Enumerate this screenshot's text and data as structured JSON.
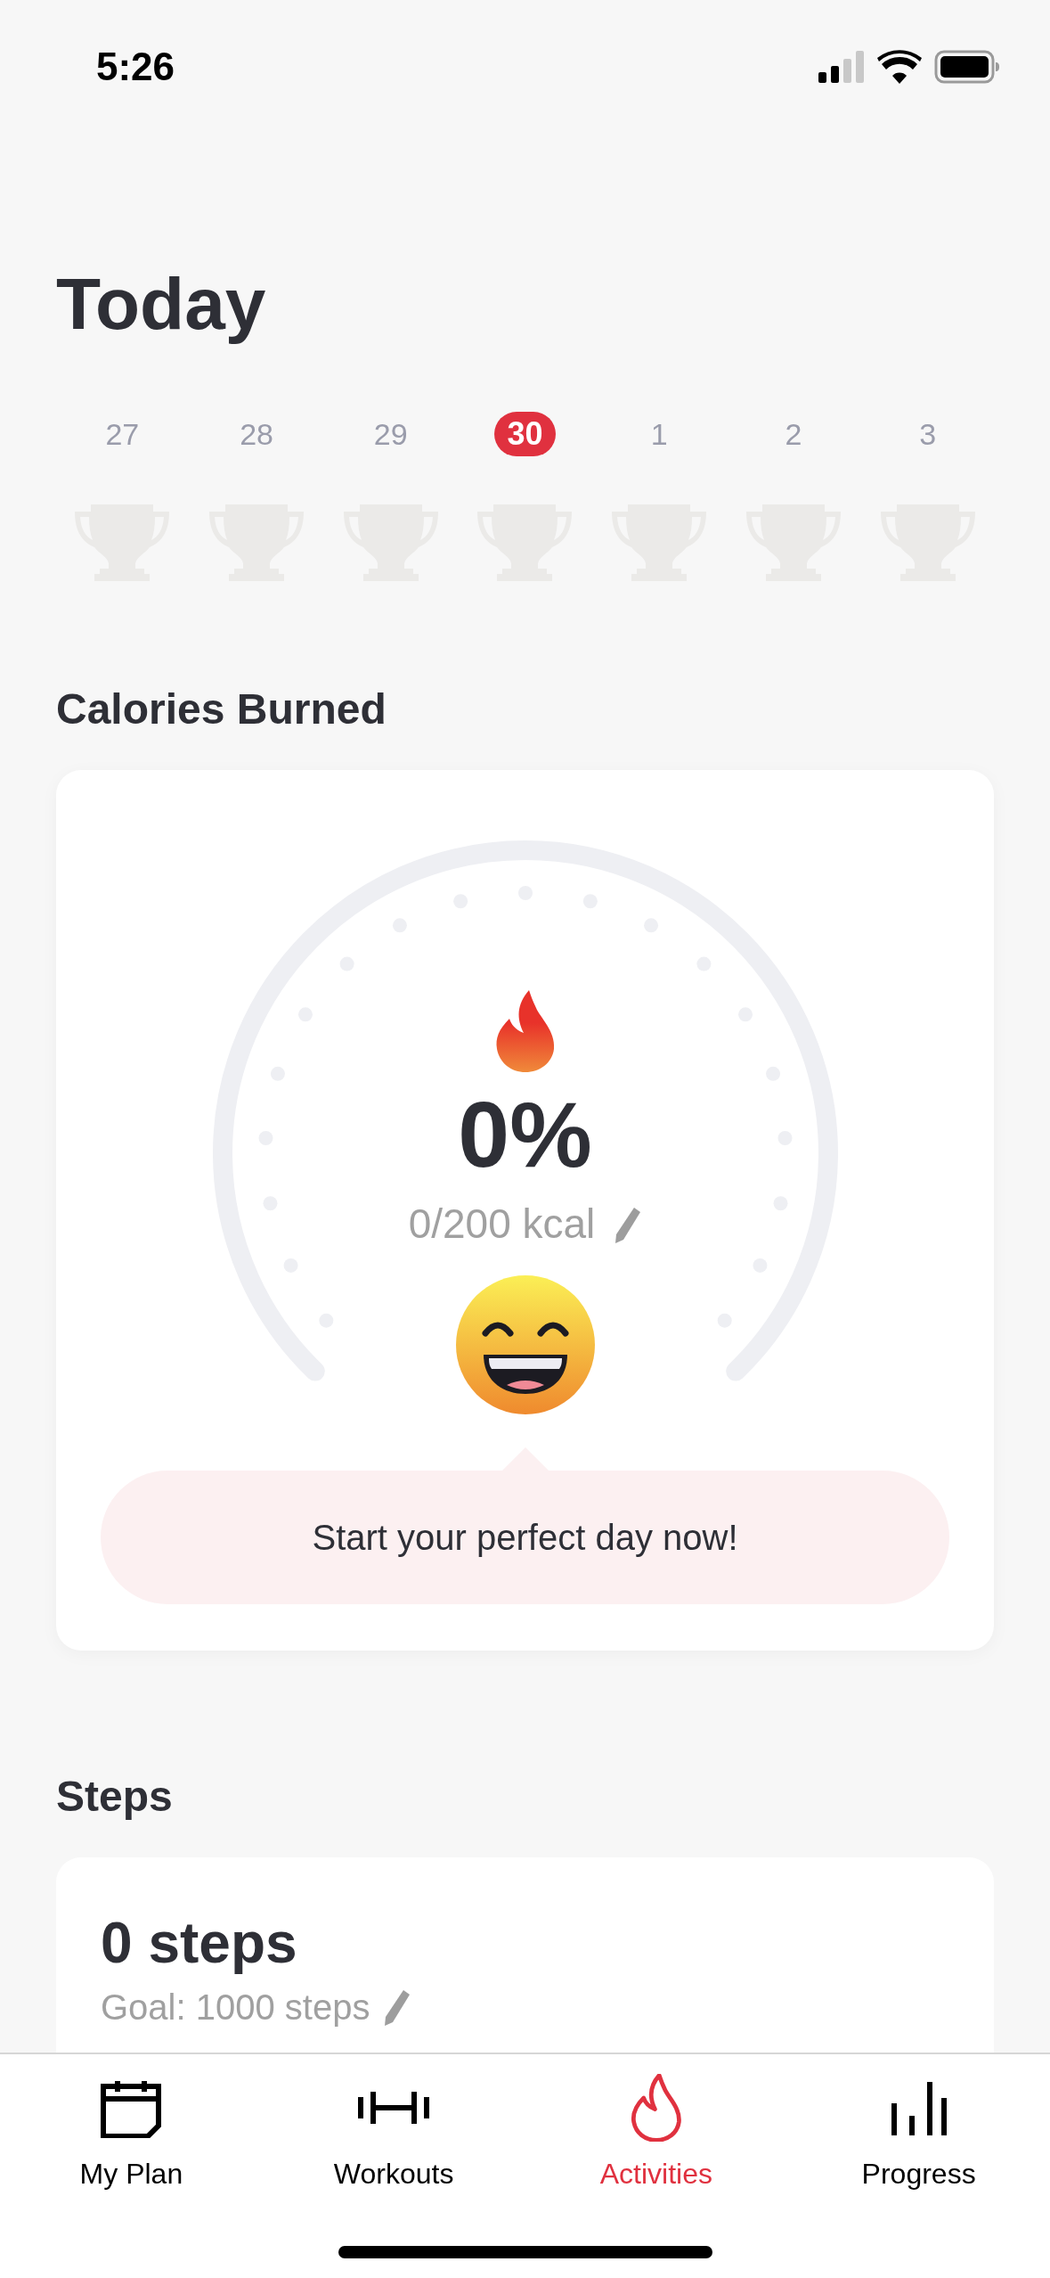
{
  "status_bar": {
    "time": "5:26"
  },
  "title": "Today",
  "days": [
    {
      "label": "27",
      "selected": false
    },
    {
      "label": "28",
      "selected": false
    },
    {
      "label": "29",
      "selected": false
    },
    {
      "label": "30",
      "selected": true
    },
    {
      "label": "1",
      "selected": false
    },
    {
      "label": "2",
      "selected": false
    },
    {
      "label": "3",
      "selected": false
    }
  ],
  "calories": {
    "title": "Calories Burned",
    "percent": "0%",
    "reading": "0/200 kcal",
    "message": "Start your perfect day now!"
  },
  "steps": {
    "title": "Steps",
    "value": "0 steps",
    "goal": "Goal: 1000 steps"
  },
  "tab_bar": [
    {
      "label": "My Plan",
      "kind": "plan",
      "selected": false
    },
    {
      "label": "Workouts",
      "kind": "workouts",
      "selected": false
    },
    {
      "label": "Activities",
      "kind": "activities",
      "selected": true
    },
    {
      "label": "Progress",
      "kind": "progress",
      "selected": false
    }
  ]
}
